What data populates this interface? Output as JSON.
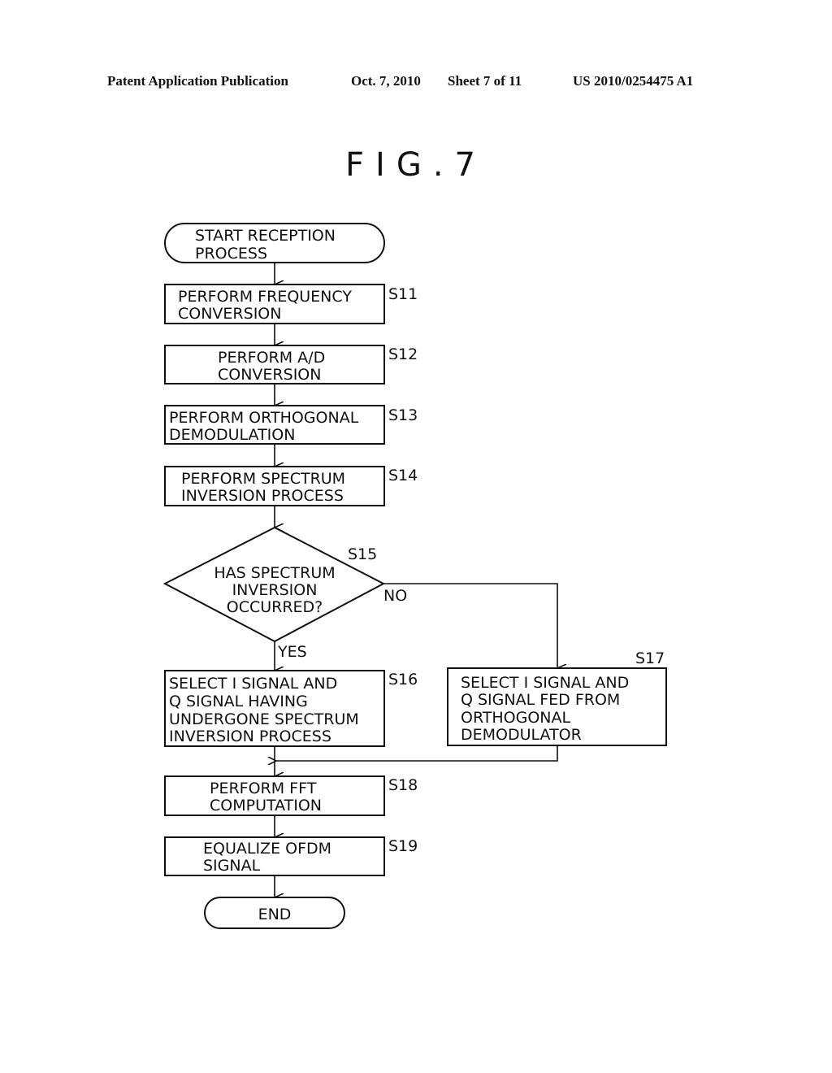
{
  "header": {
    "publication": "Patent Application Publication",
    "date": "Oct. 7, 2010",
    "sheet": "Sheet 7 of 11",
    "number": "US 2010/0254475 A1"
  },
  "figure_title": "FIG.7",
  "flowchart": {
    "start": {
      "lines": [
        "START RECEPTION",
        "PROCESS"
      ]
    },
    "steps": [
      {
        "id": "S11",
        "lines": [
          "PERFORM FREQUENCY",
          "CONVERSION"
        ]
      },
      {
        "id": "S12",
        "lines": [
          "PERFORM A/D",
          "CONVERSION"
        ]
      },
      {
        "id": "S13",
        "lines": [
          "PERFORM ORTHOGONAL",
          "DEMODULATION"
        ]
      },
      {
        "id": "S14",
        "lines": [
          "PERFORM SPECTRUM",
          "INVERSION PROCESS"
        ]
      }
    ],
    "decision": {
      "id": "S15",
      "lines": [
        "HAS SPECTRUM",
        "INVERSION",
        "OCCURRED?"
      ],
      "yes_label": "YES",
      "no_label": "NO"
    },
    "yes_branch": {
      "id": "S16",
      "lines": [
        "SELECT I SIGNAL AND",
        "Q SIGNAL HAVING",
        "UNDERGONE SPECTRUM",
        "INVERSION PROCESS"
      ]
    },
    "no_branch": {
      "id": "S17",
      "lines": [
        "SELECT I SIGNAL AND",
        "Q SIGNAL FED FROM",
        "ORTHOGONAL",
        "DEMODULATOR"
      ]
    },
    "after": [
      {
        "id": "S18",
        "lines": [
          "PERFORM FFT",
          "COMPUTATION"
        ]
      },
      {
        "id": "S19",
        "lines": [
          "EQUALIZE OFDM",
          "SIGNAL"
        ]
      }
    ],
    "end": {
      "lines": [
        "END"
      ]
    }
  }
}
